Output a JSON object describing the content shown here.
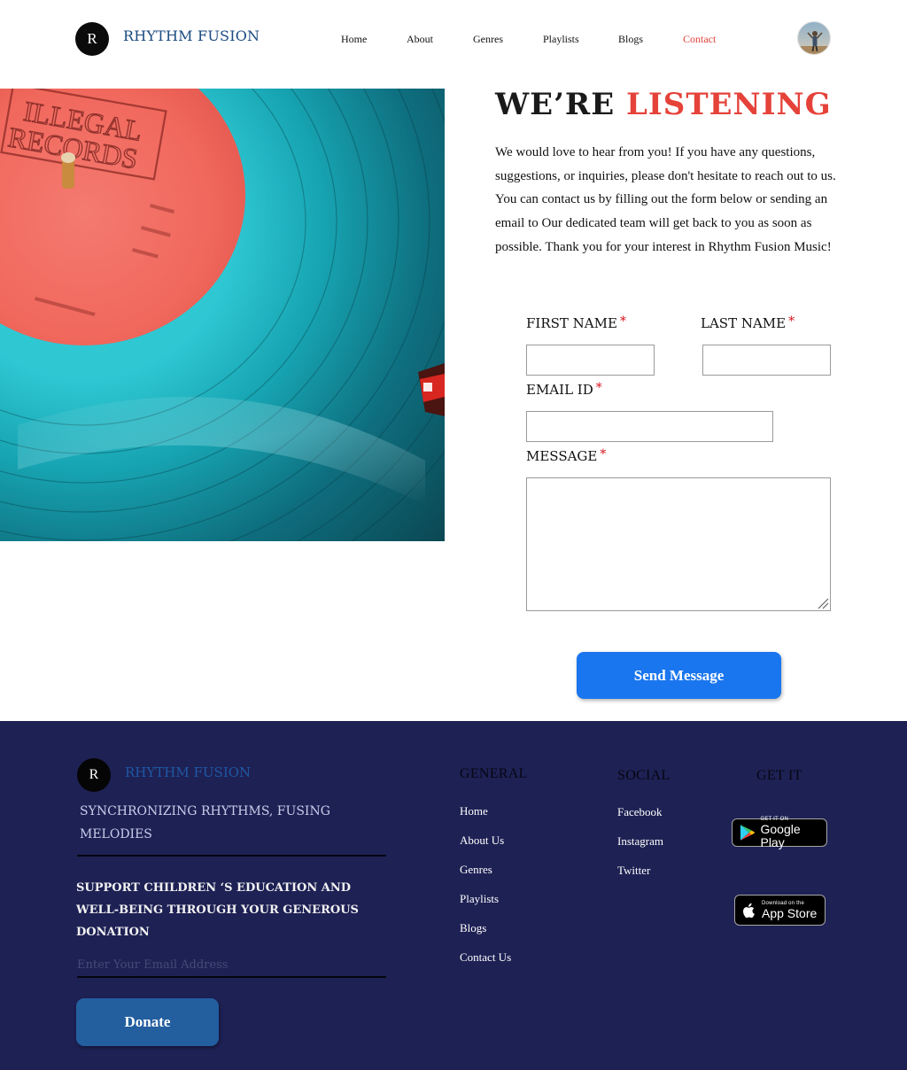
{
  "header": {
    "logo_letter": "R",
    "brand": "RHYTHM FUSION",
    "nav": [
      {
        "label": "Home"
      },
      {
        "label": "About"
      },
      {
        "label": "Genres"
      },
      {
        "label": "Playlists"
      },
      {
        "label": "Blogs"
      },
      {
        "label": "Contact"
      }
    ],
    "active_nav": "Contact"
  },
  "hero": {
    "record_label_line1": "ILLEGAL",
    "record_label_line2": "RECORDS"
  },
  "contact": {
    "title_part1": "WE’RE",
    "title_part2": "LISTENING",
    "intro": "We would love to hear from you! If you have any questions, suggestions, or inquiries, please don't hesitate to reach out to us. You can contact us by filling out the form below or sending an email to Our dedicated team will get back to you as soon as possible. Thank you for your interest in Rhythm Fusion Music!",
    "form": {
      "first_name_label": "FIRST NAME",
      "last_name_label": "LAST NAME",
      "email_label": "EMAIL ID",
      "message_label": "MESSAGE",
      "required_mark": "*",
      "first_name_value": "",
      "last_name_value": "",
      "email_value": "",
      "message_value": ""
    },
    "send_label": "Send Message"
  },
  "footer": {
    "logo_letter": "R",
    "brand": "RHYTHM FUSION",
    "tagline": "SYNCHRONIZING RHYTHMS, FUSING MELODIES",
    "donation_text": "SUPPORT CHILDREN ‘S EDUCATION AND WELL-BEING THROUGH YOUR GENEROUS DONATION",
    "email_placeholder": "Enter Your Email Address",
    "donate_label": "Donate",
    "general": {
      "heading": "GENERAL",
      "links": [
        "Home",
        "About Us",
        "Genres",
        "Playlists",
        "Blogs",
        "Contact Us"
      ]
    },
    "social": {
      "heading": "SOCIAL",
      "links": [
        "Facebook",
        "Instagram",
        "Twitter"
      ]
    },
    "get_it": {
      "heading": "GET IT",
      "google_small": "GET IT ON",
      "google_big": "Google Play",
      "apple_small": "Download on the",
      "apple_big": "App Store"
    }
  },
  "colors": {
    "accent_red": "#e5423a",
    "brand_blue": "#1b4a80",
    "button_blue": "#1a76ee",
    "footer_bg": "#1e2154",
    "donate_blue": "#235e9f"
  }
}
